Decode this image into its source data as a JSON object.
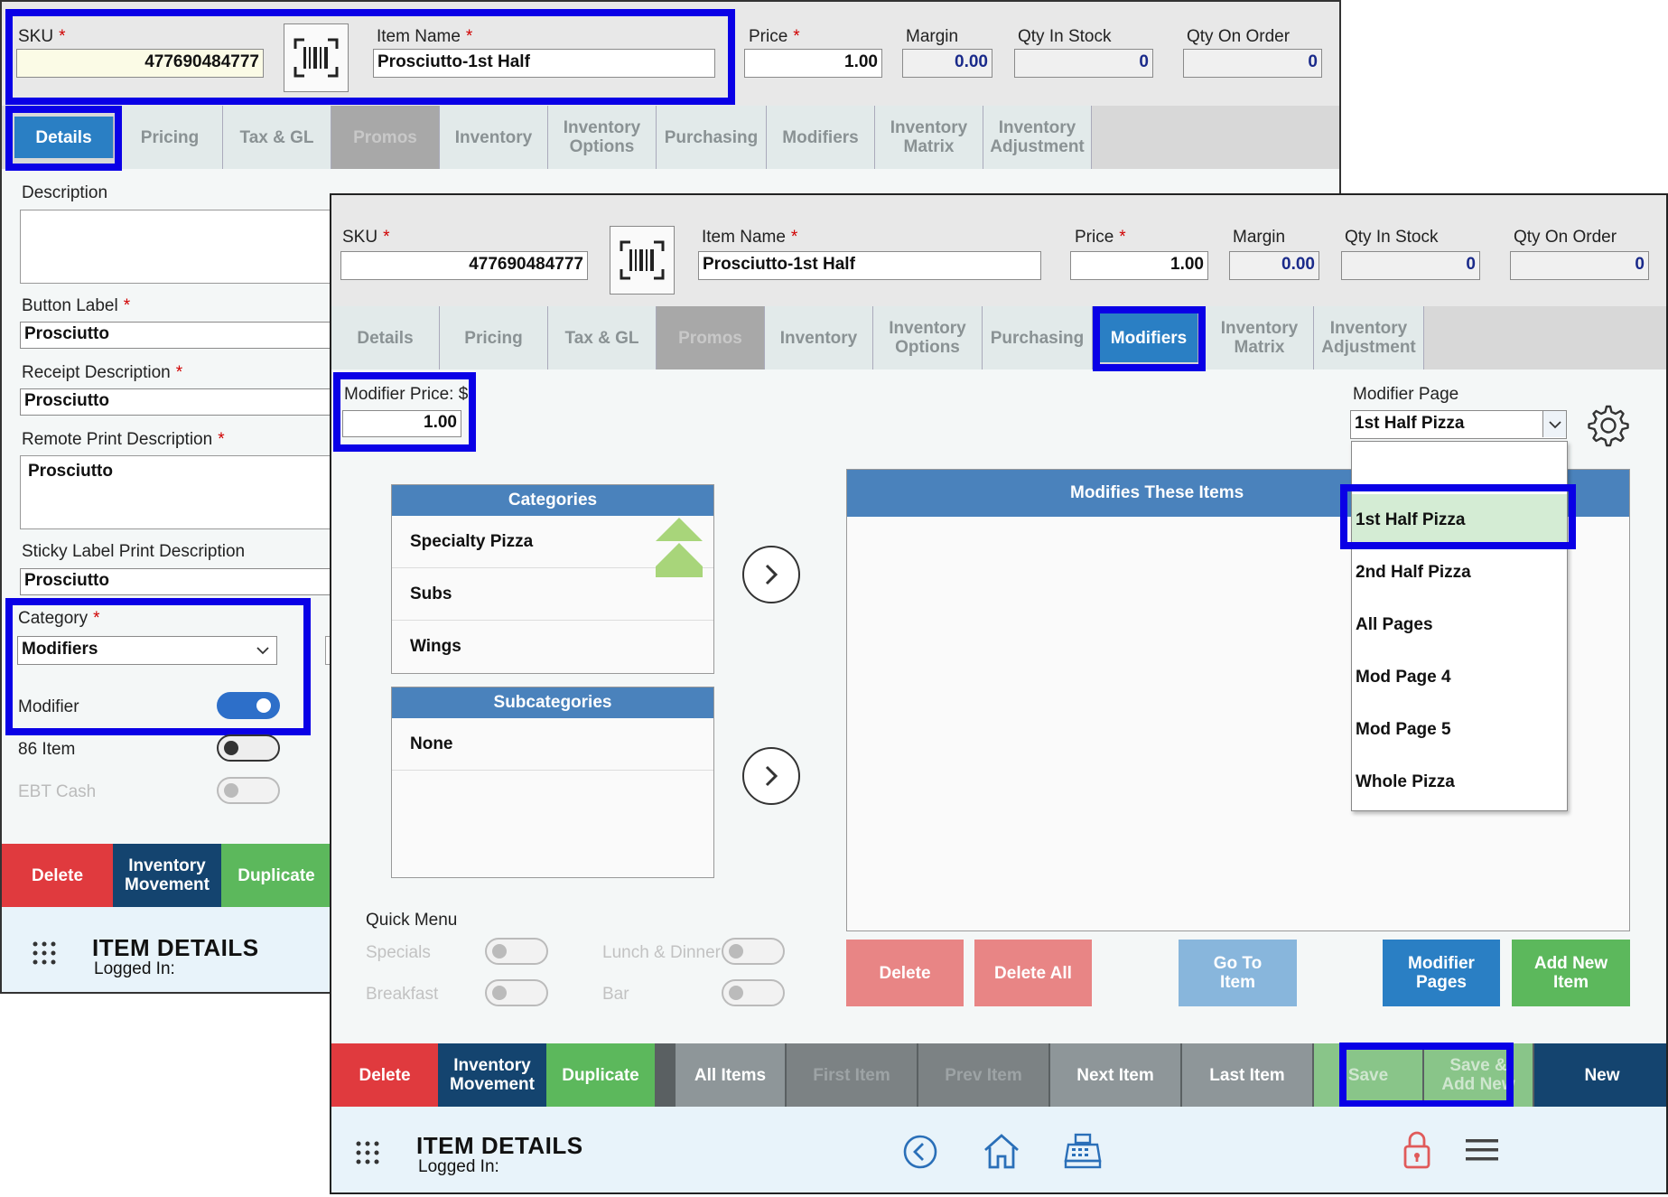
{
  "back": {
    "sku_label": "SKU",
    "sku_value": "477690484777",
    "item_name_label": "Item Name",
    "item_name_value": "Prosciutto-1st Half",
    "price_label": "Price",
    "price_value": "1.00",
    "margin_label": "Margin",
    "margin_value": "0.00",
    "qty_stock_label": "Qty In Stock",
    "qty_stock_value": "0",
    "qty_order_label": "Qty On Order",
    "qty_order_value": "0",
    "tabs": [
      "Details",
      "Pricing",
      "Tax & GL",
      "Promos",
      "Inventory",
      "Inventory Options",
      "Purchasing",
      "Modifiers",
      "Inventory Matrix",
      "Inventory Adjustment"
    ],
    "description_label": "Description",
    "button_label_label": "Button Label",
    "button_label_value": "Prosciutto",
    "receipt_label": "Receipt Description",
    "receipt_value": "Prosciutto",
    "remote_label": "Remote Print Description",
    "remote_value": "Prosciutto",
    "sticky_label": "Sticky Label Print Description",
    "sticky_value": "Prosciutto",
    "category_label": "Category",
    "category_value": "Modifiers",
    "modifier_label": "Modifier",
    "item86_label": "86 Item",
    "ebt_label": "EBT Cash",
    "delete_label": "Delete",
    "inv_movement_label": "Inventory Movement",
    "duplicate_label": "Duplicate",
    "footer_title": "ITEM DETAILS",
    "footer_sub": "Logged In:"
  },
  "front": {
    "sku_label": "SKU",
    "sku_value": "477690484777",
    "item_name_label": "Item Name",
    "item_name_value": "Prosciutto-1st Half",
    "price_label": "Price",
    "price_value": "1.00",
    "margin_label": "Margin",
    "margin_value": "0.00",
    "qty_stock_label": "Qty In Stock",
    "qty_stock_value": "0",
    "qty_order_label": "Qty On Order",
    "qty_order_value": "0",
    "tabs": [
      "Details",
      "Pricing",
      "Tax & GL",
      "Promos",
      "Inventory",
      "Inventory Options",
      "Purchasing",
      "Modifiers",
      "Inventory Matrix",
      "Inventory Adjustment"
    ],
    "modifier_price_label": "Modifier Price: $",
    "modifier_price_value": "1.00",
    "modifier_page_label": "Modifier Page",
    "modifier_page_value": "1st Half Pizza",
    "modifier_page_options": [
      "",
      "1st Half Pizza",
      "2nd Half Pizza",
      "All Pages",
      "Mod Page 4",
      "Mod Page 5",
      "Whole Pizza"
    ],
    "categories_header": "Categories",
    "categories": [
      "Specialty Pizza",
      "Subs",
      "Wings"
    ],
    "subcategories_header": "Subcategories",
    "subcategories": [
      "None"
    ],
    "modifies_header": "Modifies These Items",
    "quick_menu_label": "Quick Menu",
    "quick_specials": "Specials",
    "quick_lunch": "Lunch & Dinner",
    "quick_breakfast": "Breakfast",
    "quick_bar": "Bar",
    "panel_buttons": {
      "delete": "Delete",
      "delete_all": "Delete All",
      "go_to_item": "Go To Item",
      "modifier_pages": "Modifier Pages",
      "add_new_item": "Add New Item"
    },
    "bottom_buttons": {
      "delete": "Delete",
      "inv_movement": "Inventory Movement",
      "duplicate": "Duplicate",
      "all_items": "All Items",
      "first_item": "First Item",
      "prev_item": "Prev Item",
      "next_item": "Next Item",
      "last_item": "Last Item",
      "save": "Save",
      "save_add_new": "Save & Add New",
      "new": "New"
    },
    "footer_title": "ITEM DETAILS",
    "footer_sub": "Logged In:"
  },
  "colors": {
    "active_tab": "#2a7fc4",
    "highlight": "#0a00e6",
    "delete_red": "#e03a3e",
    "navy": "#14446f",
    "green": "#5cb85c",
    "blue_button": "#2a7fc4"
  }
}
